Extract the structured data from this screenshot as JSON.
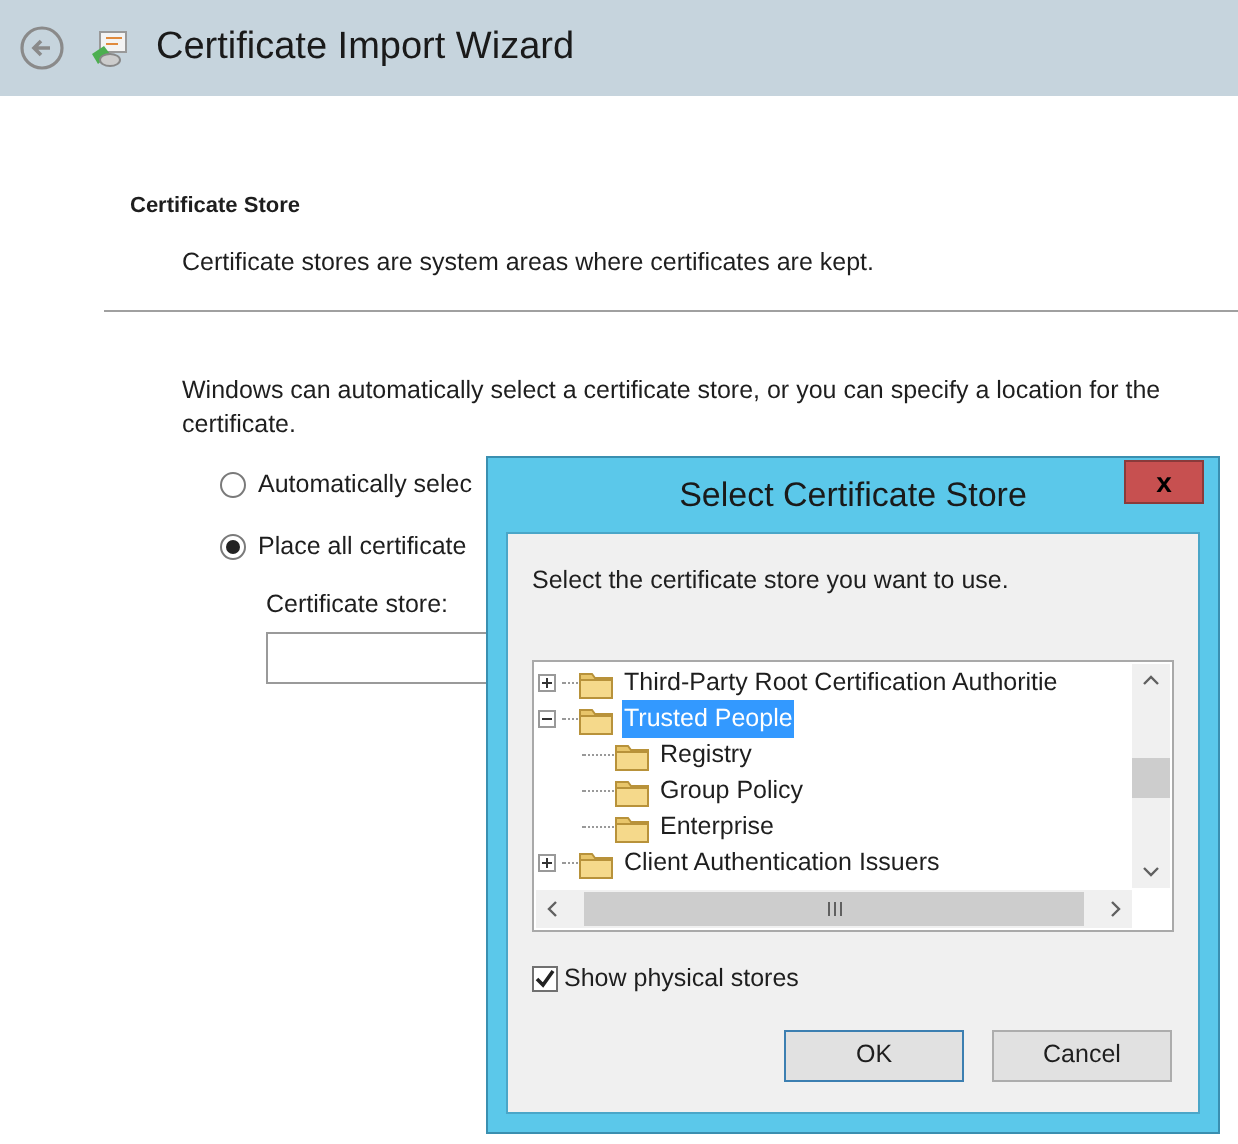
{
  "window": {
    "title": "Certificate Import Wizard"
  },
  "page": {
    "heading": "Certificate Store",
    "subtitle": "Certificate stores are system areas where certificates are kept.",
    "intro": "Windows can automatically select a certificate store, or you can specify a location for the certificate.",
    "options": [
      {
        "label": "Automatically selec",
        "selected": false
      },
      {
        "label": "Place all certificate",
        "selected": true
      }
    ],
    "store_label": "Certificate store:"
  },
  "dialog": {
    "title": "Select Certificate Store",
    "close": "x",
    "prompt": "Select the certificate store you want to use.",
    "tree": [
      {
        "label": "Third-Party Root Certification Authoritie",
        "expanded": false,
        "selected": false
      },
      {
        "label": "Trusted People",
        "expanded": true,
        "selected": true,
        "children": [
          {
            "label": "Registry",
            "selected": false
          },
          {
            "label": "Group Policy",
            "selected": false
          },
          {
            "label": "Enterprise",
            "selected": false
          }
        ]
      },
      {
        "label": "Client Authentication Issuers",
        "expanded": false,
        "selected": false
      }
    ],
    "show_physical": {
      "label": "Show physical stores",
      "checked": true
    },
    "buttons": [
      {
        "label": "OK",
        "default": true
      },
      {
        "label": "Cancel",
        "default": false
      }
    ]
  }
}
